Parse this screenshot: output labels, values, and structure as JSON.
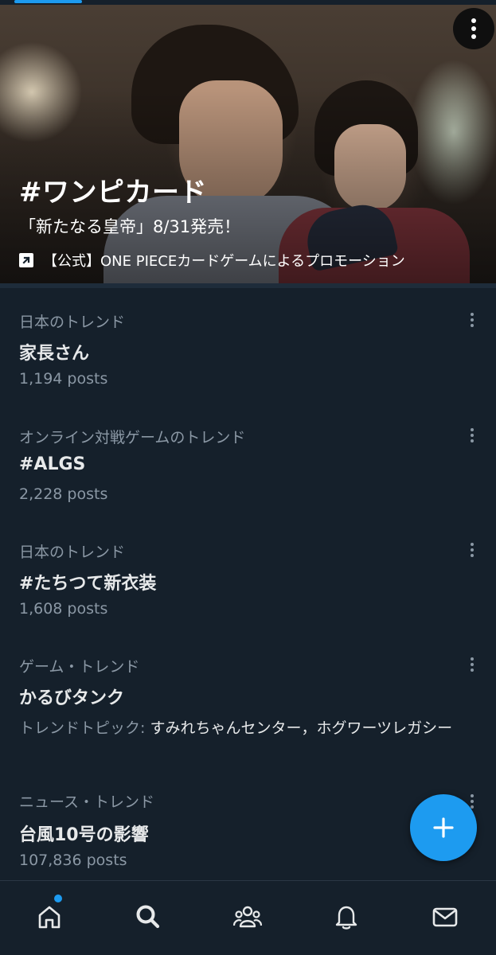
{
  "hero": {
    "title": "#ワンピカード",
    "subtitle": "「新たなる皇帝」8/31発売！",
    "promoted_by": "【公式】ONE PIECEカードゲームによるプロモーション"
  },
  "trends": [
    {
      "category": "日本のトレンド",
      "name": "家長さん",
      "count": "1,194 posts"
    },
    {
      "category": "オンライン対戦ゲームのトレンド",
      "name": "#ALGS",
      "count": "2,228 posts"
    },
    {
      "category": "日本のトレンド",
      "name": "#たちつて新衣装",
      "count": "1,608 posts"
    },
    {
      "category": "ゲーム・トレンド",
      "name": "かるびタンク",
      "topics_label": "トレンドトピック:",
      "topics": " すみれちゃんセンター，ホグワーツレガシー"
    },
    {
      "category": "ニュース・トレンド",
      "name": "台風10号の影響",
      "count": "107,836 posts"
    }
  ],
  "nav": {
    "items": [
      "home-icon",
      "search-icon",
      "communities-icon",
      "notifications-icon",
      "messages-icon"
    ],
    "active": "search-icon"
  },
  "colors": {
    "accent": "#1d9bf0",
    "background": "#15202b",
    "secondary_text": "#8b98a5"
  }
}
